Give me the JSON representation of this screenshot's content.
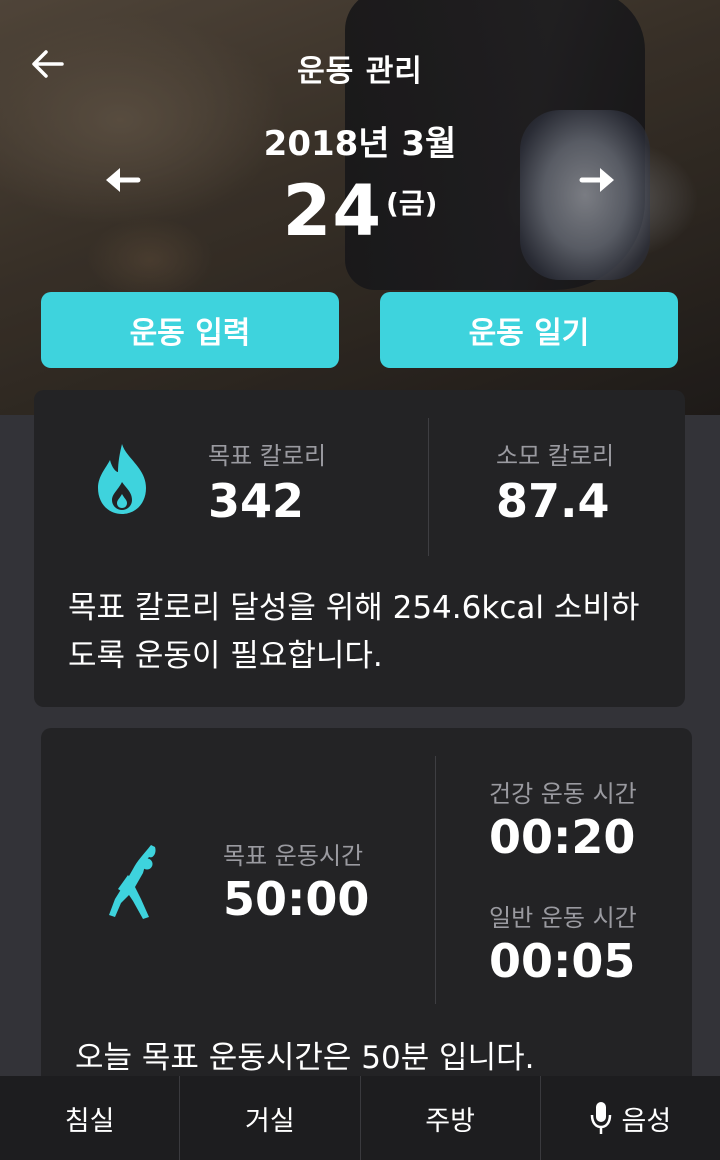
{
  "header": {
    "title": "운동 관리",
    "back_icon": "back-arrow-icon"
  },
  "date": {
    "year_month": "2018년 3월",
    "day": "24",
    "weekday": "(금)",
    "prev_icon": "arrow-left-icon",
    "next_icon": "arrow-right-icon"
  },
  "actions": {
    "input_label": "운동 입력",
    "diary_label": "운동 일기"
  },
  "calories": {
    "icon": "flame-icon",
    "target_label": "목표 칼로리",
    "target_value": "342",
    "burned_label": "소모 칼로리",
    "burned_value": "87.4",
    "message_line1": "목표 칼로리 달성을 위해 254.6kcal 소비하",
    "message_line2": "도록 운동이 필요합니다."
  },
  "exercise": {
    "icon": "stretching-person-icon",
    "target_label": "목표 운동시간",
    "target_value": "50:00",
    "healthy_label": "건강 운동 시간",
    "healthy_value": "00:20",
    "general_label": "일반 운동 시간",
    "general_value": "00:05",
    "message": "오늘 목표 운동시간은 50분 입니다."
  },
  "bottom_nav": {
    "items": [
      "침실",
      "거실",
      "주방",
      "음성"
    ],
    "voice_icon": "microphone-icon"
  },
  "colors": {
    "accent": "#3ed3dd",
    "card_bg": "#232325",
    "page_bg": "#333338",
    "nav_bg": "#1d1d1f"
  }
}
